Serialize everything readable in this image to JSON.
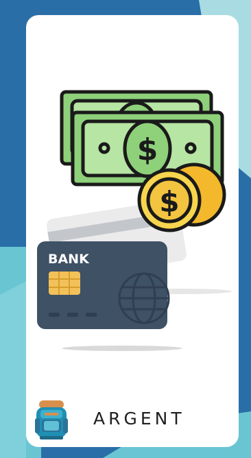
{
  "brand": {
    "name": "ARGENT"
  },
  "illustration": {
    "card_label": "BANK",
    "currency_symbol": "$"
  },
  "colors": {
    "bg_dark_blue": "#2a6ea8",
    "bg_teal": "#69c5d2",
    "bg_light": "#a9dbe2",
    "card_navy": "#3e5165",
    "chip": "#f3c15a",
    "cash_green": "#8ed17a",
    "cash_light": "#b7e5a3",
    "coin_yellow": "#f7d54d"
  },
  "icons": {
    "illustration": "money-and-bank-card-icon",
    "brand_logo": "backpack-icon"
  }
}
